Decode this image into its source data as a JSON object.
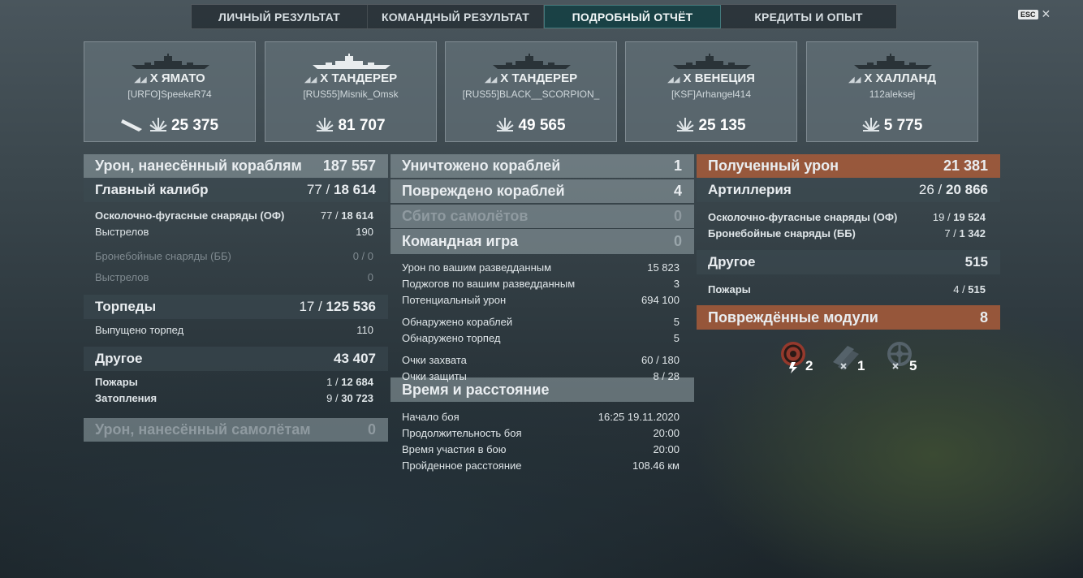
{
  "tabs": [
    "ЛИЧНЫЙ РЕЗУЛЬТАТ",
    "КОМАНДНЫЙ РЕЗУЛЬТАТ",
    "ПОДРОБНЫЙ ОТЧЁТ",
    "КРЕДИТЫ И ОПЫТ"
  ],
  "active_tab": "ПОДРОБНЫЙ ОТЧЁТ",
  "esc": {
    "key": "ESC",
    "close": "✕"
  },
  "ships": [
    {
      "tier": "X",
      "name": "ЯМАТО",
      "player": "[URFO]SpeekeR74",
      "damage": "25 375",
      "sunk": true
    },
    {
      "tier": "X",
      "name": "ТАНДЕРЕР",
      "player": "[RUS55]Misnik_Omsk",
      "damage": "81 707",
      "sunk": false
    },
    {
      "tier": "X",
      "name": "ТАНДЕРЕР",
      "player": "[RUS55]BLACK__SCORPION_",
      "damage": "49 565",
      "sunk": false
    },
    {
      "tier": "X",
      "name": "ВЕНЕЦИЯ",
      "player": "[KSF]Arhangel414",
      "damage": "25 135",
      "sunk": false
    },
    {
      "tier": "X",
      "name": "ХАЛЛАНД",
      "player": "112aleksej",
      "damage": "5 775",
      "sunk": false
    }
  ],
  "left": {
    "ship_damage": {
      "label": "Урон, нанесённый кораблям",
      "value": "187 557"
    },
    "main_battery": {
      "label": "Главный калибр",
      "hits": "77",
      "value": "18 614"
    },
    "he": {
      "label": "Осколочно-фугасные снаряды (ОФ)",
      "hits": "77",
      "value": "18 614"
    },
    "he_shots": {
      "label": "Выстрелов",
      "value": "190"
    },
    "ap": {
      "label": "Бронебойные снаряды (ББ)",
      "value": "0 / 0"
    },
    "ap_shots": {
      "label": "Выстрелов",
      "value": "0"
    },
    "torpedoes": {
      "label": "Торпеды",
      "hits": "17",
      "value": "125 536"
    },
    "torp_launched": {
      "label": "Выпущено торпед",
      "value": "110"
    },
    "other": {
      "label": "Другое",
      "value": "43 407"
    },
    "fires": {
      "label": "Пожары",
      "hits": "1",
      "value": "12 684"
    },
    "floods": {
      "label": "Затопления",
      "hits": "9",
      "value": "30 723"
    },
    "plane_damage": {
      "label": "Урон, нанесённый самолётам",
      "value": "0"
    }
  },
  "middle": {
    "destroyed": {
      "label": "Уничтожено кораблей",
      "value": "1"
    },
    "damaged": {
      "label": "Повреждено кораблей",
      "value": "4"
    },
    "planes": {
      "label": "Сбито самолётов",
      "value": "0"
    },
    "team": {
      "label": "Командная игра",
      "value": "0"
    },
    "team_rows": [
      {
        "label": "Урон по вашим разведданным",
        "value": "15 823"
      },
      {
        "label": "Поджогов по вашим разведданным",
        "value": "3"
      },
      {
        "label": "Потенциальный урон",
        "value": "694 100"
      },
      {
        "label": "Обнаружено кораблей",
        "value": "5"
      },
      {
        "label": "Обнаружено торпед",
        "value": "5"
      },
      {
        "label": "Очки захвата",
        "value": "60 / 180"
      },
      {
        "label": "Очки защиты",
        "value": "8 / 28"
      }
    ],
    "time": {
      "label": "Время и расстояние"
    },
    "time_rows": [
      {
        "label": "Начало боя",
        "value": "16:25  19.11.2020"
      },
      {
        "label": "Продолжительность боя",
        "value": "20:00"
      },
      {
        "label": "Время участия в бою",
        "value": "20:00"
      },
      {
        "label": "Пройденное расстояние",
        "value": "108.46 км"
      }
    ]
  },
  "right": {
    "received": {
      "label": "Полученный урон",
      "value": "21 381"
    },
    "artillery": {
      "label": "Артиллерия",
      "hits": "26",
      "value": "20 866"
    },
    "he": {
      "label": "Осколочно-фугасные снаряды (ОФ)",
      "hits": "19",
      "value": "19 524"
    },
    "ap": {
      "label": "Бронебойные снаряды (ББ)",
      "hits": "7",
      "value": "1 342"
    },
    "other": {
      "label": "Другое",
      "value": "515"
    },
    "fires": {
      "label": "Пожары",
      "hits": "4",
      "value": "515"
    },
    "modules": {
      "label": "Повреждённые модули",
      "value": "8"
    },
    "module_counts": {
      "engine": "2",
      "turret": "1",
      "steering": "5"
    }
  },
  "colors": {
    "accent_orange": "#a85c3a",
    "active_tab": "#14464a"
  }
}
